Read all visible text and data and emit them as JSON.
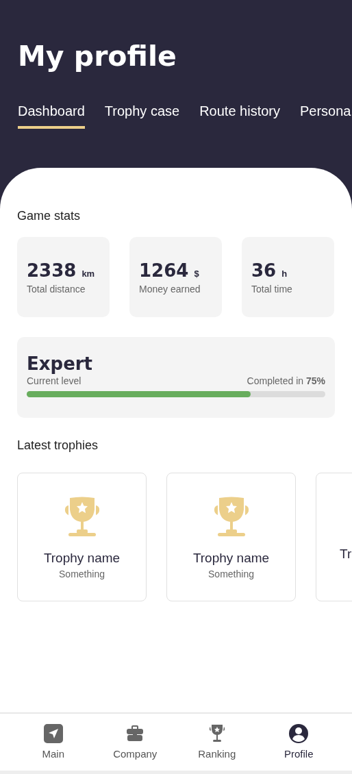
{
  "header": {
    "title": "My profile"
  },
  "tabs": [
    {
      "label": "Dashboard",
      "selected": true
    },
    {
      "label": "Trophy case",
      "selected": false
    },
    {
      "label": "Route history",
      "selected": false
    },
    {
      "label": "Persona",
      "selected": false
    }
  ],
  "game_stats": {
    "heading": "Game stats",
    "stats": [
      {
        "value": "2338",
        "unit": "km",
        "label": "Total distance"
      },
      {
        "value": "1264",
        "unit": "$",
        "label": "Money earned"
      },
      {
        "value": "36",
        "unit": "h",
        "label": "Total time"
      }
    ]
  },
  "level": {
    "name": "Expert",
    "caption": "Current level",
    "progress_text": "Completed in **75%**",
    "level": 0.75
  },
  "latest_trophies": {
    "heading": "Latest trophies",
    "items": [
      {
        "kind": "full",
        "name": "Trophy name",
        "subtitle": "Something"
      },
      {
        "kind": "full",
        "name": "Trophy name",
        "subtitle": "Something"
      },
      {
        "kind": "partial",
        "name": "Tr"
      }
    ]
  },
  "bottom_nav": [
    {
      "label": "Main",
      "kind": "navigate",
      "selected": false
    },
    {
      "label": "Company",
      "kind": "briefcase",
      "selected": false
    },
    {
      "label": "Ranking",
      "kind": "trophy",
      "selected": false
    },
    {
      "label": "Profile",
      "kind": "person",
      "selected": true
    }
  ]
}
